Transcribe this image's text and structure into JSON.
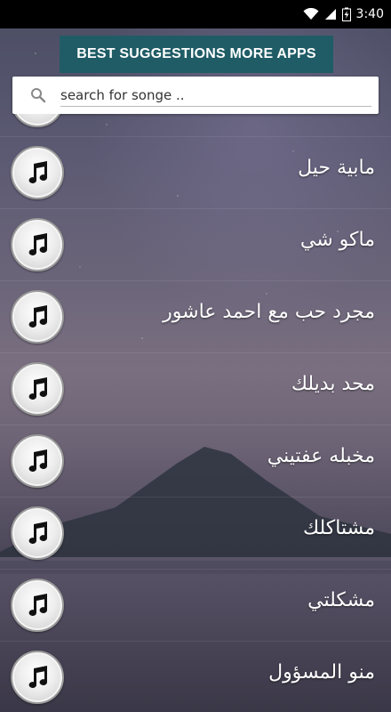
{
  "status_bar": {
    "time": "3:40"
  },
  "banner": {
    "label": "BEST SUGGESTIONS MORE APPS"
  },
  "search": {
    "placeholder": "search for songe .."
  },
  "songs": [
    {
      "title": ""
    },
    {
      "title": "مابية حيل"
    },
    {
      "title": "ماكو شي"
    },
    {
      "title": "مجرد حب مع احمد عاشور"
    },
    {
      "title": "محد بديلك"
    },
    {
      "title": "مخبله عفتيني"
    },
    {
      "title": "مشتاكلك"
    },
    {
      "title": "مشكلتي"
    },
    {
      "title": "منو المسؤول"
    }
  ],
  "icons": {
    "status": [
      "wifi-icon",
      "cellular-signal-icon",
      "battery-charging-icon"
    ],
    "search": "search-icon",
    "song": "music-note-icon"
  },
  "colors": {
    "banner_bg": "#1f5c66",
    "status_bar_bg": "#000000",
    "song_text": "#ffffff"
  }
}
